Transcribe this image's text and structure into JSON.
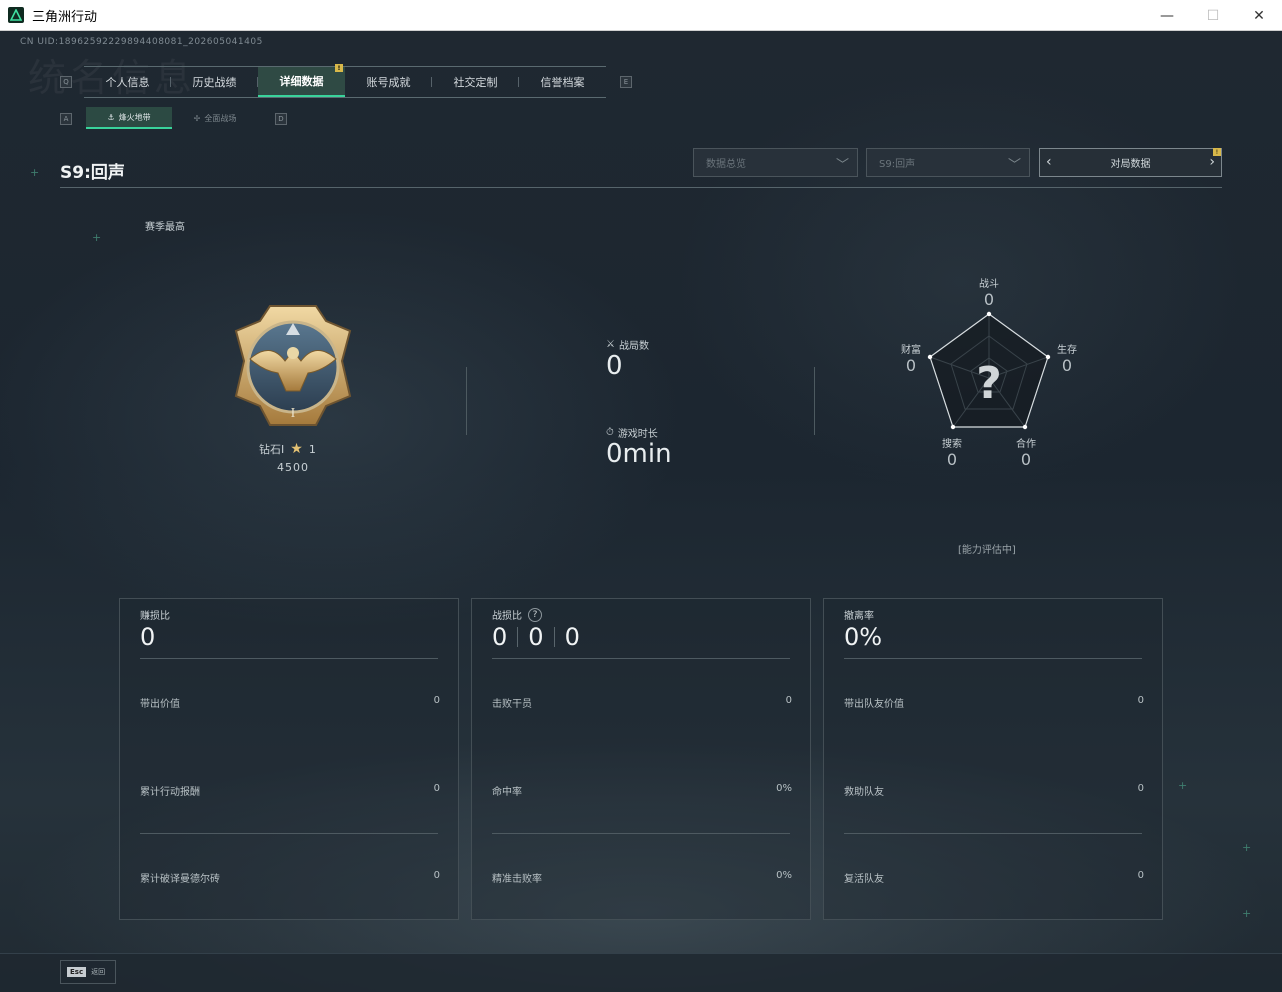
{
  "window": {
    "title": "三角洲行动"
  },
  "uid": "CN UID:18962592229894408081_202605041405",
  "ghost_text": "统名信息",
  "nav": {
    "left_key": "Q",
    "right_key": "E",
    "tabs": [
      {
        "label": "个人信息"
      },
      {
        "label": "历史战绩"
      },
      {
        "label": "详细数据",
        "active": true,
        "badge": "!"
      },
      {
        "label": "账号成就"
      },
      {
        "label": "社交定制"
      },
      {
        "label": "信誉档案"
      }
    ]
  },
  "subnav": {
    "left_key": "A",
    "right_key": "D",
    "tabs": [
      {
        "label": "烽火地带",
        "active": true
      },
      {
        "label": "全面战场"
      }
    ]
  },
  "season_title": "S9:回声",
  "filters": {
    "data_select": "数据总览",
    "season_select": "S9:回声",
    "match_data_label": "对局数据",
    "match_badge": "!"
  },
  "season_best_label": "赛季最高",
  "rank": {
    "name": "钻石I",
    "stars": "1",
    "score": "4500"
  },
  "stats": {
    "matches_label": "战局数",
    "matches_value": "0",
    "playtime_label": "游戏时长",
    "playtime_value": "0min"
  },
  "radar": {
    "combat": {
      "label": "战斗",
      "value": "0"
    },
    "survival": {
      "label": "生存",
      "value": "0"
    },
    "cooperation": {
      "label": "合作",
      "value": "0"
    },
    "search": {
      "label": "搜索",
      "value": "0"
    },
    "wealth": {
      "label": "财富",
      "value": "0"
    },
    "center_mark": "?",
    "status": "[能力评估中]"
  },
  "panels": [
    {
      "title": "赚损比",
      "big": [
        "0"
      ],
      "rows": [
        {
          "label": "带出价值",
          "value": "0"
        },
        {
          "label": "累计行动报酬",
          "value": "0"
        },
        {
          "label": "累计破译曼德尔砖",
          "value": "0"
        }
      ]
    },
    {
      "title": "战损比",
      "help": "?",
      "big": [
        "0",
        "0",
        "0"
      ],
      "rows": [
        {
          "label": "击败干员",
          "value": "0"
        },
        {
          "label": "命中率",
          "value": "0%"
        },
        {
          "label": "精准击败率",
          "value": "0%"
        }
      ]
    },
    {
      "title": "撤离率",
      "big": [
        "0%"
      ],
      "rows": [
        {
          "label": "带出队友价值",
          "value": "0"
        },
        {
          "label": "救助队友",
          "value": "0"
        },
        {
          "label": "复活队友",
          "value": "0"
        }
      ]
    }
  ],
  "footer": {
    "esc_key": "Esc",
    "esc_label": "返回"
  }
}
